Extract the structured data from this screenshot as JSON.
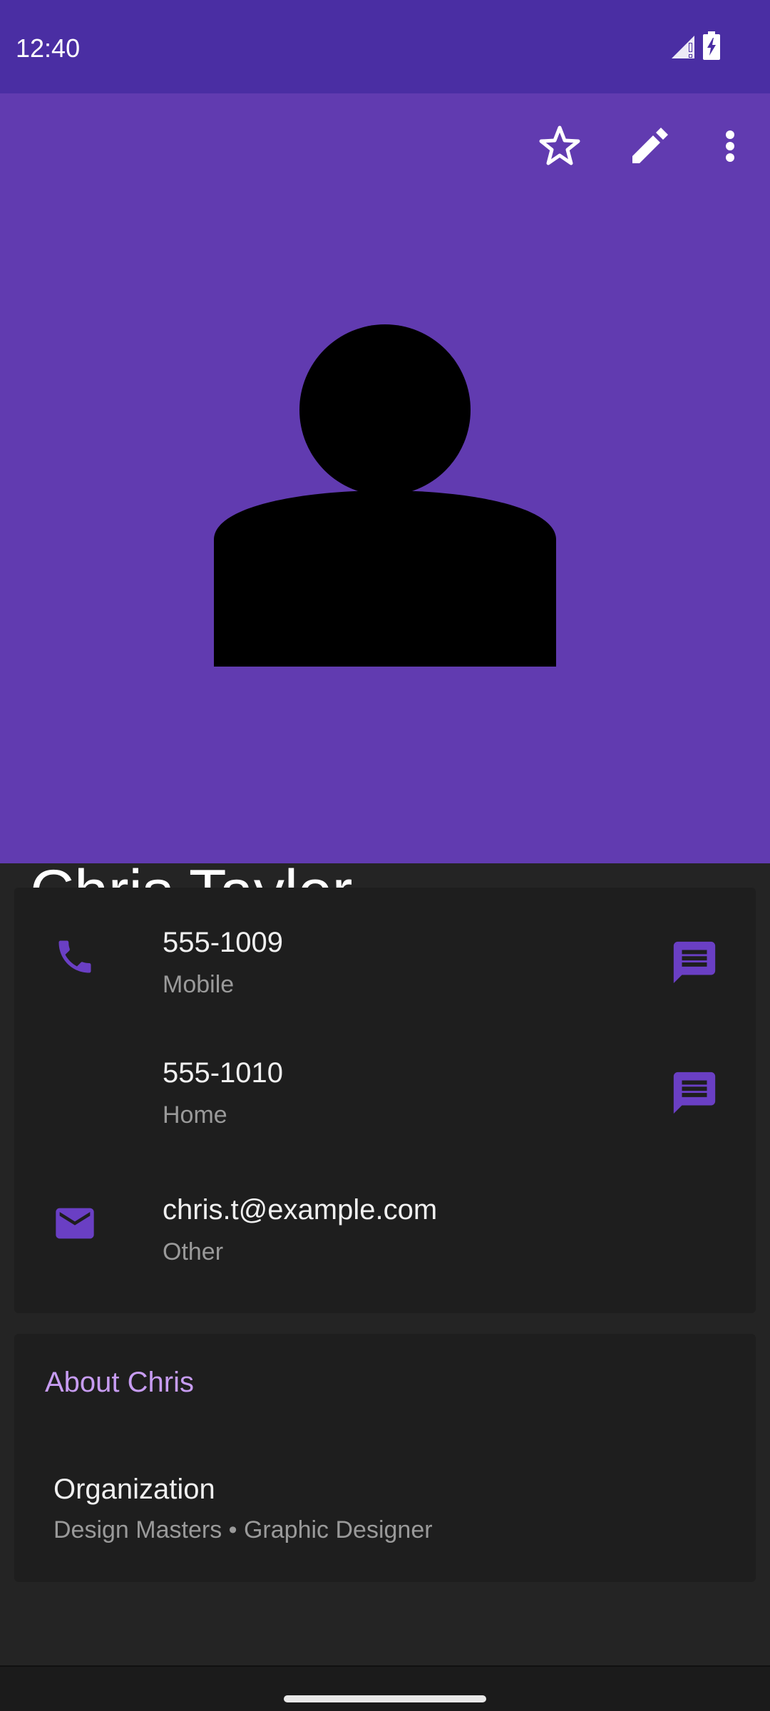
{
  "status_bar": {
    "time": "12:40",
    "icons": [
      "signal-icon",
      "battery-charging-icon"
    ]
  },
  "toolbar": {
    "actions": [
      "star-outline-icon",
      "edit-pencil-icon",
      "more-vert-icon"
    ]
  },
  "header": {
    "name": "Chris Taylor",
    "avatar": "person-silhouette-icon"
  },
  "contact_rows": [
    {
      "value": "555-1009",
      "label": "Mobile",
      "icon": "phone-icon",
      "action": "message-icon"
    },
    {
      "value": "555-1010",
      "label": "Home",
      "icon": "",
      "action": "message-icon"
    },
    {
      "value": "chris.t@example.com",
      "label": "Other",
      "icon": "email-icon",
      "action": ""
    }
  ],
  "about": {
    "title": "About Chris",
    "organization_title": "Organization",
    "organization_detail": "Design Masters • Graphic Designer"
  },
  "colors": {
    "status_bar": "#4a2ea3",
    "header": "#613bb0",
    "accent": "#6a3fc4",
    "about_title": "#c79cf2",
    "card": "#1e1e1e",
    "background": "#242424"
  }
}
